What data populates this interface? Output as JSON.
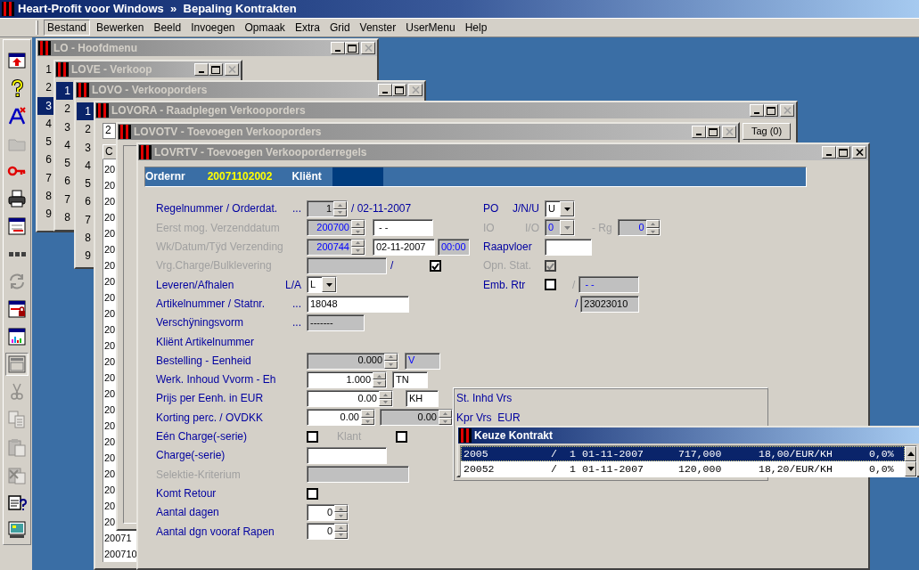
{
  "app_title": "Heart-Profit voor Windows  »  Bepaling Kontrakten",
  "menu": [
    {
      "label": "Bestand",
      "selected": true
    },
    {
      "label": "Bewerken",
      "selected": false
    },
    {
      "label": "Beeld",
      "selected": false
    },
    {
      "label": "Invoegen",
      "selected": false
    },
    {
      "label": "Opmaak",
      "selected": false
    },
    {
      "label": "Extra",
      "selected": false
    },
    {
      "label": "Grid",
      "selected": false
    },
    {
      "label": "Venster",
      "selected": false
    },
    {
      "label": "UserMenu",
      "selected": false
    },
    {
      "label": "Help",
      "selected": false
    }
  ],
  "toolbar": [
    {
      "kind": "upload",
      "disabled": false,
      "pressed": false
    },
    {
      "kind": "help",
      "disabled": false,
      "pressed": false
    },
    {
      "kind": "font",
      "disabled": false,
      "pressed": false
    },
    {
      "kind": "folder",
      "disabled": true,
      "pressed": false
    },
    {
      "kind": "key",
      "disabled": false,
      "pressed": false
    },
    {
      "kind": "printer",
      "disabled": false,
      "pressed": false
    },
    {
      "kind": "form",
      "disabled": false,
      "pressed": false
    },
    {
      "kind": "dots",
      "disabled": false,
      "pressed": false
    },
    {
      "kind": "refresh",
      "disabled": true,
      "pressed": false
    },
    {
      "kind": "lock",
      "disabled": false,
      "pressed": false
    },
    {
      "kind": "chart",
      "disabled": false,
      "pressed": false
    },
    {
      "kind": "window",
      "disabled": false,
      "pressed": true
    },
    {
      "kind": "cut",
      "disabled": true,
      "pressed": false
    },
    {
      "kind": "copy",
      "disabled": true,
      "pressed": false
    },
    {
      "kind": "paste",
      "disabled": true,
      "pressed": false
    },
    {
      "kind": "paste_delete",
      "disabled": true,
      "pressed": false
    },
    {
      "kind": "clipboard_help",
      "disabled": false,
      "pressed": false
    },
    {
      "kind": "monitor",
      "disabled": false,
      "pressed": false
    }
  ],
  "windows": [
    {
      "kind": "list",
      "title": "LO - Hoofdmenu",
      "active": false,
      "close_disabled": true,
      "items": [
        {
          "label": "1",
          "selected": false
        },
        {
          "label": "2",
          "selected": false
        },
        {
          "label": "3",
          "selected": true
        },
        {
          "label": "4",
          "selected": false
        },
        {
          "label": "5",
          "selected": false
        },
        {
          "label": "6",
          "selected": false
        },
        {
          "label": "7",
          "selected": false
        },
        {
          "label": "8",
          "selected": false
        },
        {
          "label": "9",
          "selected": false
        }
      ]
    },
    {
      "kind": "list",
      "title": "LOVE - Verkoop",
      "active": false,
      "close_disabled": true,
      "items": [
        {
          "label": "1",
          "selected": true
        },
        {
          "label": "2",
          "selected": false
        },
        {
          "label": "3",
          "selected": false
        },
        {
          "label": "4",
          "selected": false
        },
        {
          "label": "5",
          "selected": false
        },
        {
          "label": "6",
          "selected": false
        },
        {
          "label": "7",
          "selected": false
        },
        {
          "label": "8",
          "selected": false
        }
      ]
    },
    {
      "kind": "list",
      "title": "LOVO - Verkooporders",
      "active": false,
      "close_disabled": true,
      "items": [
        {
          "label": "1",
          "selected": true
        },
        {
          "label": "2",
          "selected": false
        },
        {
          "label": "3",
          "selected": false
        },
        {
          "label": "4",
          "selected": false
        },
        {
          "label": "5",
          "selected": false
        },
        {
          "label": "6",
          "selected": false
        },
        {
          "label": "7",
          "selected": false
        },
        {
          "label": "8",
          "selected": false
        },
        {
          "label": "9",
          "selected": false
        }
      ]
    },
    {
      "kind": "browse",
      "title": "LOVORA - Raadplegen Verkooporders",
      "active": false,
      "close_disabled": true,
      "tab_label": "2",
      "column_header": "C",
      "tag_button": "Tag (0)",
      "rows": [
        "20",
        "20",
        "20",
        "20",
        "20",
        "20",
        "20",
        "20",
        "20",
        "20",
        "20",
        "20",
        "20",
        "20",
        "20",
        "20",
        "20",
        "20",
        "20",
        "20",
        "20",
        "20",
        "20",
        "20071",
        "200710"
      ]
    },
    {
      "kind": "frame",
      "title": "LOVOTV - Toevoegen Verkooporders",
      "active": false,
      "close_disabled": true
    },
    {
      "kind": "form",
      "title": "LOVRTV - Toevoegen Verkooporderregels",
      "active": false,
      "close_disabled": false,
      "header": {
        "order_label": "Ordernr",
        "order_number": "20071102002",
        "client_label": "Kliënt"
      },
      "left_rows": [
        {
          "label": "Regelnummer / Orderdat.",
          "mid": "...",
          "disabled": false,
          "controls": [
            {
              "kind": "spin",
              "value": "1",
              "readonly": true,
              "computed": false
            },
            {
              "kind": "label",
              "text": "/ 02-11-2007",
              "disabled": false
            }
          ]
        },
        {
          "label": "Eerst mog. Verzenddatum",
          "disabled": true,
          "controls": [
            {
              "kind": "spin",
              "value": "200700",
              "readonly": true,
              "computed": true
            },
            {
              "kind": "text",
              "value": " - -",
              "readonly": false,
              "computed": false
            }
          ]
        },
        {
          "label": "Wk/Datum/Tÿd Verzending",
          "disabled": true,
          "controls": [
            {
              "kind": "spin",
              "value": "200744",
              "readonly": true,
              "computed": true
            },
            {
              "kind": "text",
              "value": "02-11-2007",
              "readonly": false,
              "computed": false
            },
            {
              "kind": "text",
              "value": "00:00",
              "readonly": true,
              "computed": true
            }
          ]
        },
        {
          "label": "Vrg.Charge/Bulklevering",
          "disabled": true,
          "controls": [
            {
              "kind": "text",
              "readonly": true
            },
            {
              "kind": "label",
              "text": "/",
              "disabled": false
            },
            {
              "kind": "check",
              "checked": true,
              "disabled": false
            }
          ]
        },
        {
          "label": "Leveren/Afhalen",
          "mid": "L/A",
          "disabled": false,
          "controls": [
            {
              "kind": "select",
              "value": "L",
              "readonly": false,
              "computed": false
            }
          ]
        },
        {
          "label": "Artikelnummer / Statnr.",
          "mid": "...",
          "disabled": false,
          "controls": [
            {
              "kind": "text",
              "value": "18048",
              "readonly": false,
              "computed": false
            }
          ]
        },
        {
          "label": "Verschÿningsvorm",
          "mid": "...",
          "disabled": false,
          "controls": [
            {
              "kind": "text",
              "value": "-------",
              "readonly": true,
              "computed": false
            }
          ]
        },
        {
          "label": "Kliënt Artikelnummer",
          "disabled": false,
          "controls": []
        },
        {
          "label": "Bestelling - Eenheid",
          "disabled": false,
          "controls": [
            {
              "kind": "spin",
              "value": "0.000",
              "readonly": true,
              "computed": false
            },
            {
              "kind": "text",
              "value": "V",
              "readonly": true,
              "computed": true
            }
          ]
        },
        {
          "label": "Werk. Inhoud Vvorm - Eh",
          "disabled": false,
          "controls": [
            {
              "kind": "spin",
              "value": "1.000",
              "readonly": false,
              "computed": false
            },
            {
              "kind": "text",
              "value": "TN",
              "readonly": false,
              "computed": false
            }
          ]
        },
        {
          "label": "Prijs per Eenh. in EUR",
          "disabled": false,
          "controls": [
            {
              "kind": "spin",
              "value": "0.00",
              "readonly": false,
              "computed": false
            },
            {
              "kind": "text",
              "value": "KH",
              "readonly": false,
              "computed": false
            }
          ]
        },
        {
          "label": "Korting perc. / OVDKK",
          "disabled": false,
          "controls": [
            {
              "kind": "spin",
              "value": "0.00",
              "readonly": false,
              "computed": false
            },
            {
              "kind": "spin",
              "value": "0.00",
              "readonly": true,
              "computed": false
            }
          ]
        },
        {
          "label": "Eén Charge(-serie)",
          "disabled": false,
          "controls": [
            {
              "kind": "check",
              "checked": false,
              "disabled": false
            },
            {
              "kind": "label",
              "text": "Klant",
              "disabled": true
            },
            {
              "kind": "check",
              "checked": false,
              "disabled": false
            }
          ]
        },
        {
          "label": "Charge(-serie)",
          "disabled": false,
          "controls": [
            {
              "kind": "text",
              "readonly": false
            }
          ]
        },
        {
          "label": "Selektie-Kriterium",
          "disabled": true,
          "controls": [
            {
              "kind": "text",
              "readonly": true
            }
          ]
        },
        {
          "label": "Komt Retour",
          "disabled": false,
          "controls": [
            {
              "kind": "check",
              "checked": false,
              "disabled": false
            }
          ]
        },
        {
          "label": "Aantal dagen",
          "disabled": false,
          "controls": [
            {
              "kind": "spin",
              "value": "0",
              "readonly": false,
              "computed": false
            }
          ]
        },
        {
          "label": "Aantal dgn vooraf Rapen",
          "disabled": false,
          "controls": [
            {
              "kind": "spin",
              "value": "0",
              "readonly": false,
              "computed": false
            }
          ]
        }
      ],
      "right_rows": [
        {
          "label": "PO",
          "mid": "J/N/U",
          "disabled": false,
          "controls": [
            {
              "kind": "select",
              "value": "U",
              "readonly": false,
              "computed": false
            }
          ]
        },
        {
          "label": "IO",
          "mid": "I/O",
          "disabled": true,
          "controls": [
            {
              "kind": "select",
              "value": "0",
              "readonly": true,
              "computed": true
            },
            {
              "kind": "label",
              "text": "- Rg",
              "disabled": true
            },
            {
              "kind": "spin",
              "value": "0",
              "readonly": true,
              "computed": true
            }
          ]
        },
        {
          "label": "Raapvloer",
          "disabled": false,
          "controls": [
            {
              "kind": "text",
              "readonly": false
            }
          ]
        },
        {
          "label": "Opn. Stat.",
          "disabled": true,
          "controls": [
            {
              "kind": "check",
              "checked": true,
              "disabled": true
            }
          ]
        },
        {
          "label": "Emb. Rtr",
          "disabled": false,
          "controls": [
            {
              "kind": "check",
              "checked": false,
              "disabled": false
            },
            {
              "kind": "label",
              "text": "/",
              "disabled": true
            },
            {
              "kind": "text",
              "value": " - -",
              "readonly": true,
              "computed": true
            }
          ]
        },
        {
          "controls": [
            {
              "kind": "label",
              "text": "/",
              "disabled": false
            },
            {
              "kind": "text",
              "value": "23023010",
              "readonly": true,
              "computed": false
            }
          ]
        }
      ],
      "group": {
        "lines": [
          "St. Inhd Vrs",
          "Kpr Vrs  EUR"
        ]
      }
    }
  ],
  "popup": {
    "title": "Keuze Kontrakt",
    "active": true,
    "rows": [
      {
        "selected": true,
        "cells": [
          "2005",
          "/",
          "1",
          "01-11-2007",
          "717,000",
          "18,00/EUR/KH",
          "0,0%"
        ]
      },
      {
        "selected": false,
        "cells": [
          "20052",
          "/",
          "1",
          "01-11-2007",
          "120,000",
          "18,20/EUR/KH",
          "0,0%"
        ]
      }
    ]
  }
}
